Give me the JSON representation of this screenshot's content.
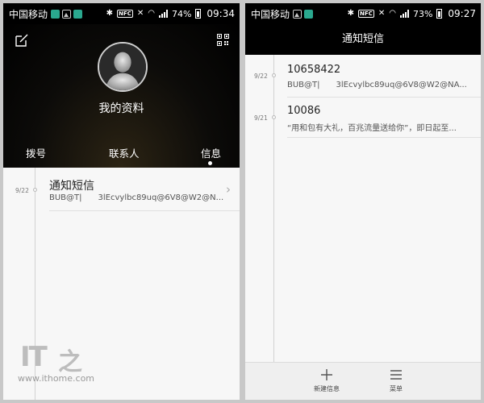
{
  "left_screen": {
    "status": {
      "carrier": "中国移动",
      "nfc": "NFC",
      "battery": "74%",
      "time": "09:34"
    },
    "profile_title": "我的资料",
    "tabs": [
      {
        "label": "拨号"
      },
      {
        "label": "联系人"
      },
      {
        "label": "信息",
        "active": true
      }
    ],
    "messages": [
      {
        "date": "9/22",
        "title": "通知短信",
        "snippet_a": "BUB@T|",
        "snippet_b": "3lEcvylbc89uq@6V8@W2@N..."
      }
    ]
  },
  "right_screen": {
    "status": {
      "carrier": "中国移动",
      "nfc": "NFC",
      "battery": "73%",
      "time": "09:27"
    },
    "header_title": "通知短信",
    "messages": [
      {
        "date": "9/22",
        "title": "10658422",
        "snippet_a": "BUB@T|",
        "snippet_b": "3lEcvylbc89uq@6V8@W2@NA..."
      },
      {
        "date": "9/21",
        "title": "10086",
        "snippet": "“用和包有大礼，百兆流量送给你”，即日起至..."
      }
    ],
    "bottom_bar": {
      "new_message": "新建信息",
      "menu": "菜单"
    }
  },
  "watermark": {
    "logo": "IT之家",
    "url": "www.ithome.com"
  },
  "icons": {
    "edit": "edit-icon",
    "qr": "qr-code-icon",
    "avatar": "avatar-silhouette-icon",
    "chevron": "chevron-right-icon",
    "plus": "plus-icon",
    "menu": "hamburger-menu-icon"
  },
  "colors": {
    "header_bg": "#000000",
    "list_bg": "#f7f7f7",
    "page_bg": "#c8c8c8",
    "watermark": "#bdbdbd"
  }
}
